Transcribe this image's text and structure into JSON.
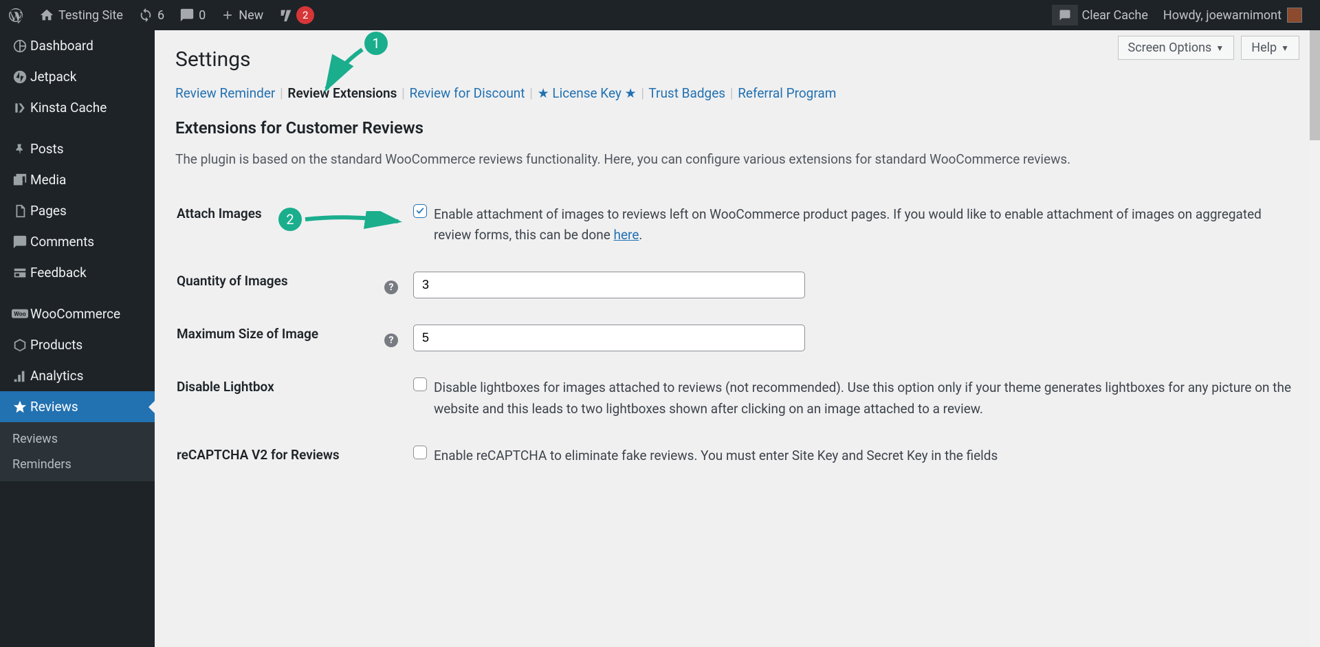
{
  "adminbar": {
    "site_name": "Testing Site",
    "updates_count": "6",
    "comments_count": "0",
    "new_label": "New",
    "yoast_count": "2",
    "clear_cache": "Clear Cache",
    "howdy": "Howdy, joewarnimont"
  },
  "sidebar": {
    "items": [
      {
        "label": "Dashboard",
        "icon": "dashboard"
      },
      {
        "label": "Jetpack",
        "icon": "jetpack"
      },
      {
        "label": "Kinsta Cache",
        "icon": "kinsta"
      },
      {
        "label": "Posts",
        "icon": "posts",
        "sep_before": true
      },
      {
        "label": "Media",
        "icon": "media"
      },
      {
        "label": "Pages",
        "icon": "pages"
      },
      {
        "label": "Comments",
        "icon": "comments"
      },
      {
        "label": "Feedback",
        "icon": "feedback"
      },
      {
        "label": "WooCommerce",
        "icon": "woo",
        "sep_before": true
      },
      {
        "label": "Products",
        "icon": "products"
      },
      {
        "label": "Analytics",
        "icon": "analytics"
      },
      {
        "label": "Reviews",
        "icon": "reviews",
        "current": true
      }
    ],
    "sub": [
      "Reviews",
      "Reminders"
    ]
  },
  "top_buttons": {
    "screen_options": "Screen Options",
    "help": "Help"
  },
  "page": {
    "title": "Settings",
    "tabs": [
      {
        "label": "Review Reminder"
      },
      {
        "label": "Review Extensions",
        "active": true
      },
      {
        "label": "Review for Discount"
      },
      {
        "label": "★ License Key ★",
        "star": true
      },
      {
        "label": "Trust Badges"
      },
      {
        "label": "Referral Program"
      }
    ],
    "section_title": "Extensions for Customer Reviews",
    "section_desc": "The plugin is based on the standard WooCommerce reviews functionality. Here, you can configure various extensions for standard WooCommerce reviews."
  },
  "form": {
    "attach_images": {
      "label": "Attach Images",
      "checked": true,
      "text_before": "Enable attachment of images to reviews left on WooCommerce product pages. If you would like to enable attachment of images on aggregated review forms, this can be done ",
      "link": "here",
      "text_after": "."
    },
    "quantity": {
      "label": "Quantity of Images",
      "value": "3"
    },
    "max_size": {
      "label": "Maximum Size of Image",
      "value": "5"
    },
    "disable_lightbox": {
      "label": "Disable Lightbox",
      "checked": false,
      "text": "Disable lightboxes for images attached to reviews (not recommended). Use this option only if your theme generates lightboxes for any picture on the website and this leads to two lightboxes shown after clicking on an image attached to a review."
    },
    "recaptcha": {
      "label": "reCAPTCHA V2 for Reviews",
      "checked": false,
      "text": "Enable reCAPTCHA to eliminate fake reviews. You must enter Site Key and Secret Key in the fields"
    }
  },
  "annotations": {
    "a1": "1",
    "a2": "2"
  }
}
